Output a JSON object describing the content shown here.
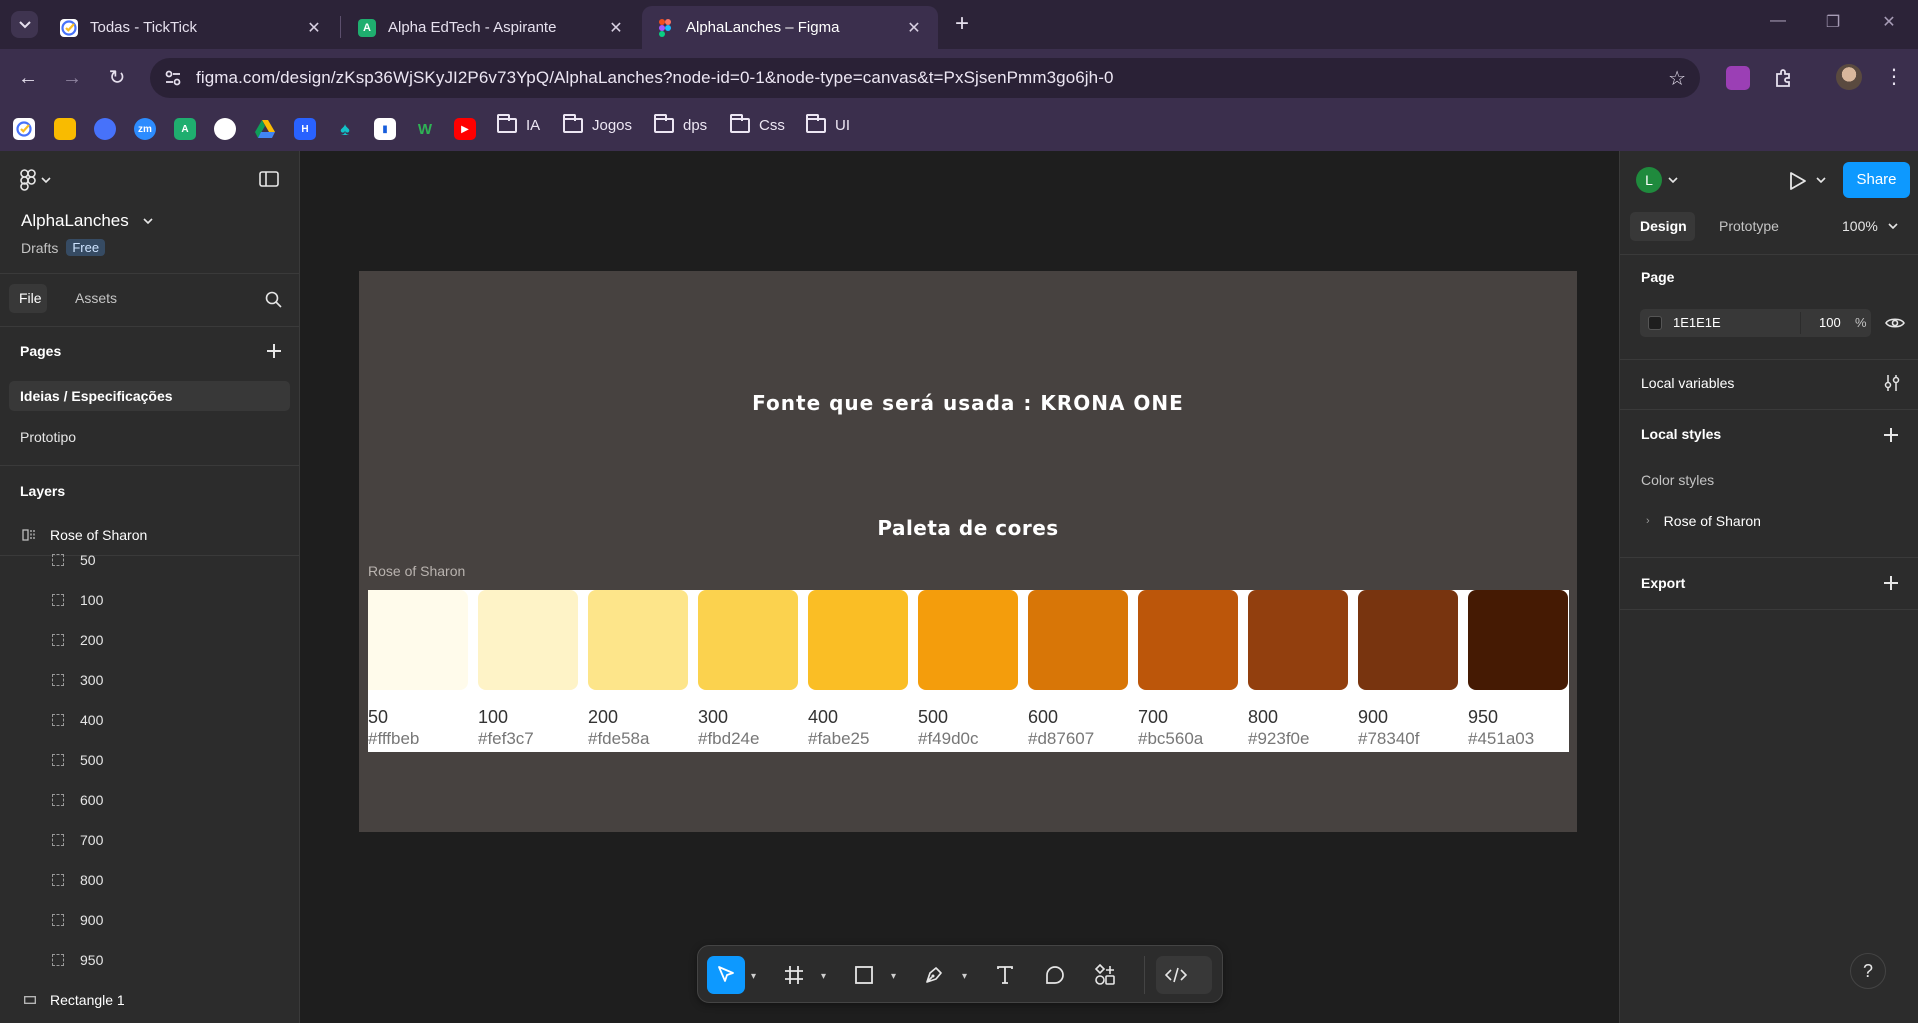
{
  "browser": {
    "tabs": [
      {
        "title": "Todas - TickTick",
        "color": "#4772fa"
      },
      {
        "title": "Alpha EdTech - Aspirante",
        "color": "#1fae6f"
      },
      {
        "title": "AlphaLanches – Figma",
        "color": "#f24e1e"
      }
    ],
    "url": "figma.com/design/zKsp36WjSKyJI2P6v73YpQ/AlphaLanches?node-id=0-1&node-type=canvas&t=PxSjsenPmm3go6jh-0",
    "bookmark_folders": [
      "IA",
      "Jogos",
      "dps",
      "Css",
      "UI"
    ],
    "bookmark_icons": [
      "ticktick-icon",
      "keep-icon",
      "clock-icon",
      "zoom-icon",
      "android-icon",
      "github-icon",
      "drive-icon",
      "hashnode-icon",
      "app-icon",
      "bitwarden-icon",
      "w-icon",
      "youtube-icon"
    ]
  },
  "figma": {
    "file_name": "AlphaLanches",
    "location": "Drafts",
    "plan_badge": "Free",
    "left_tabs": {
      "file": "File",
      "assets": "Assets"
    },
    "pages_heading": "Pages",
    "pages": [
      "Ideias / Especificações",
      "Prototipo"
    ],
    "layers_heading": "Layers",
    "layer_root": "Rose of Sharon",
    "layer_children": [
      "50",
      "100",
      "200",
      "300",
      "400",
      "500",
      "600",
      "700",
      "800",
      "900",
      "950"
    ],
    "layer_last": "Rectangle 1",
    "right_tabs": {
      "design": "Design",
      "prototype": "Prototype"
    },
    "user_initial": "L",
    "share_label": "Share",
    "zoom": "100%",
    "page_heading": "Page",
    "page_color": "1E1E1E",
    "page_opacity": "100",
    "page_opacity_unit": "%",
    "local_variables": "Local variables",
    "local_styles": "Local styles",
    "color_styles": "Color styles",
    "style_group": "Rose of Sharon",
    "export": "Export"
  },
  "canvas": {
    "title_font": "Fonte que será usada : KRONA ONE",
    "title_palette": "Paleta de cores",
    "palette_label": "Rose of Sharon",
    "swatches": [
      {
        "name": "50",
        "hex": "#fffbeb"
      },
      {
        "name": "100",
        "hex": "#fef3c7"
      },
      {
        "name": "200",
        "hex": "#fde58a"
      },
      {
        "name": "300",
        "hex": "#fbd24e"
      },
      {
        "name": "400",
        "hex": "#fabe25"
      },
      {
        "name": "500",
        "hex": "#f49d0c"
      },
      {
        "name": "600",
        "hex": "#d87607"
      },
      {
        "name": "700",
        "hex": "#bc560a"
      },
      {
        "name": "800",
        "hex": "#923f0e"
      },
      {
        "name": "900",
        "hex": "#78340f"
      },
      {
        "name": "950",
        "hex": "#451a03"
      }
    ]
  }
}
